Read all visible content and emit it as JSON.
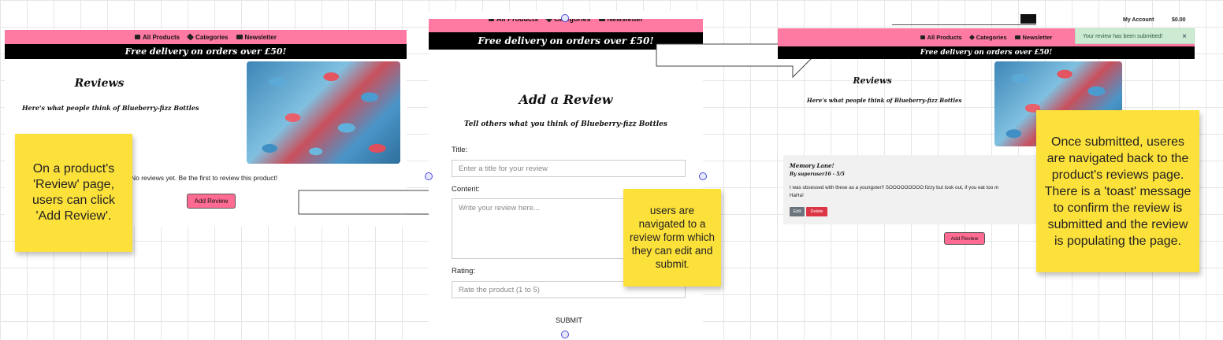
{
  "nav": {
    "all_products": "All Products",
    "categories": "Categories",
    "newsletter": "Newsletter"
  },
  "banner": "Free delivery on orders over £50!",
  "panel1": {
    "heading": "Reviews",
    "subheading": "Here's what people think of Blueberry-fizz Bottles",
    "no_reviews": "No reviews yet. Be the first to review this product!",
    "add_review": "Add Review"
  },
  "panel2": {
    "heading": "Add a Review",
    "subheading": "Tell others what you think of Blueberry-fizz Bottles",
    "title_label": "Title:",
    "title_placeholder": "Enter a title for your review",
    "content_label": "Content:",
    "content_placeholder": "Write your review here...",
    "rating_label": "Rating:",
    "rating_placeholder": "Rate the product (1 to 5)",
    "submit": "SUBMIT"
  },
  "panel3": {
    "my_account": "My Account",
    "cart_total": "$0.00",
    "toast": "Your review has been submitted!",
    "toast_close": "×",
    "heading": "Reviews",
    "subheading": "Here's what people think of Blueberry-fizz Bottles",
    "review_title": "Memory Lane!",
    "review_meta": "By superuser16 - 5/5",
    "review_body_1": "I was obsessed with these as a youngster!! SOOOOOOOOO fizzy but look out, if you eat too m",
    "review_body_2": "HaHa!",
    "edit": "Edit",
    "delete": "Delete",
    "add_review": "Add Review"
  },
  "notes": {
    "note1": "On a product's 'Review' page, users can click 'Add Review'.",
    "note2_a": "users are navigated to a review form which they can edit and submit",
    "note2_b": ".",
    "note3": "Once submitted, useres are navigated back to the product's reviews page. There is a 'toast' message to confirm the review is submitted and the review is populating the page."
  },
  "colors": {
    "brand_pink": "#ff7aa2",
    "sticky_yellow": "#fde13b",
    "toast_green": "#cdebd3",
    "delete_red": "#dc3545",
    "edit_gray": "#6c757d"
  }
}
